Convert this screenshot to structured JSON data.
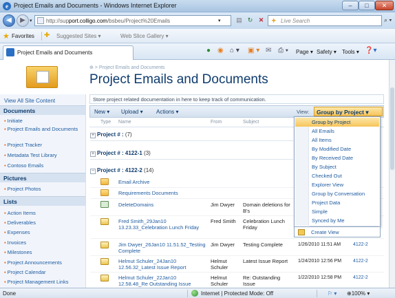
{
  "window": {
    "title": "Project Emails and Documents - Windows Internet Explorer"
  },
  "navbar": {
    "url_prefix": "http://sup",
    "url_host": "port.colligo.com",
    "url_path": "/bsbeu/Project%20Emails",
    "search_placeholder": "Live Search"
  },
  "favbar": {
    "favorites": "Favorites",
    "suggested": "Suggested Sites ▾",
    "web_slice": "Web Slice Gallery ▾"
  },
  "tabbar": {
    "tab_label": "Project Emails and Documents",
    "page": "Page ▾",
    "safety": "Safety ▾",
    "tools": "Tools ▾"
  },
  "page": {
    "breadcrumb": "⊕ > Project Emails and Documents",
    "title": "Project Emails and Documents",
    "description": "Store project related documentation in here to keep track of communication."
  },
  "quicklaunch": {
    "view_all": "View All Site Content",
    "sections": [
      {
        "heading": "Documents",
        "items": [
          "Initiate",
          "Project Emails and Documents",
          "Project Tracker",
          "Metadata Test Library",
          "Contoso Emails"
        ]
      },
      {
        "heading": "Pictures",
        "items": [
          "Project Photos"
        ]
      },
      {
        "heading": "Lists",
        "items": [
          "Action Items",
          "Deliverables",
          "Expenses",
          "Invoices",
          "Milestones",
          "Project Announcements",
          "Project Calendar",
          "Project Management Links"
        ]
      }
    ]
  },
  "toolbar": {
    "new": "New ▾",
    "upload": "Upload ▾",
    "actions": "Actions ▾",
    "view_label": "View:",
    "view_value": "Group by Project ▾"
  },
  "columns": {
    "type": "Type",
    "name": "Name",
    "from": "From",
    "subject": "Subject"
  },
  "groups": [
    {
      "label": "Project # : ",
      "count": "(7)"
    },
    {
      "label": "Project # : 4122-1",
      "count": " (3)"
    },
    {
      "label": "Project # : 4122-2",
      "count": " (14)"
    }
  ],
  "rows": [
    {
      "icon": "folder",
      "name": "Email Archive",
      "from": "",
      "subject": "",
      "date": "",
      "project": ""
    },
    {
      "icon": "folder",
      "name": "Requirements Documents",
      "from": "",
      "subject": "",
      "date": "",
      "project": ""
    },
    {
      "icon": "gear",
      "name": "DeleteDomains",
      "from": "Jim Dwyer",
      "subject": "Domain deletions for B's",
      "date": "",
      "project": ""
    },
    {
      "icon": "mail",
      "name": "Fred Smith_29Jan10 13.23.33_Celebration Lunch Friday",
      "from": "Fred Smith",
      "subject": "Celebration Lunch Friday",
      "date": "",
      "project": ""
    },
    {
      "icon": "mail",
      "name": "Jim Dwyer_26Jan10 11.51.52_Testing Complete",
      "from": "Jim Dwyer",
      "subject": "Testing Complete",
      "date": "1/26/2010 11:51 AM",
      "project": "4122-2"
    },
    {
      "icon": "mail",
      "name": "Helmut Schuler_24Jan10 12.56.32_Latest Issue Report",
      "from": "Helmut Schuler",
      "subject": "Latest Issue Report",
      "date": "1/24/2010 12:56 PM",
      "project": "4122-2"
    },
    {
      "icon": "mail",
      "name": "Helmut Schuler_22Jan10 12.58.48_Re Outstanding Issue",
      "from": "Helmut Schuler",
      "subject": "Re: Outstanding Issue",
      "date": "1/22/2010 12:58 PM",
      "project": "4122-2"
    }
  ],
  "view_menu": {
    "items": [
      "Group by Project",
      "All Emails",
      "All Items",
      "By Modified Date",
      "By Received Date",
      "By Subject",
      "Checked Out",
      "Explorer View",
      "Group by Conversation",
      "Project Data",
      "Simple",
      "Synced by Me"
    ],
    "selected_index": 0,
    "create_view": "Create View"
  },
  "status": {
    "left": "Done",
    "zone": "Internet | Protected Mode: Off",
    "zoom": "100%"
  }
}
